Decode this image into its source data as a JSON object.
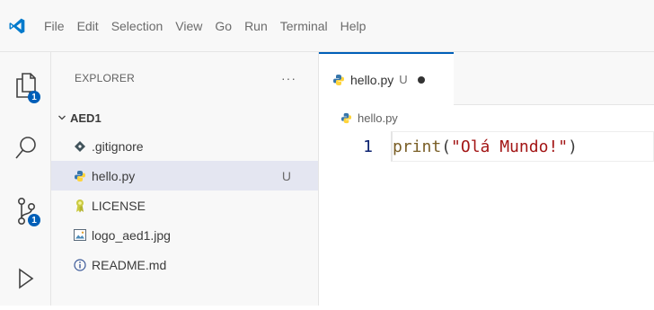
{
  "menu": [
    "File",
    "Edit",
    "Selection",
    "View",
    "Go",
    "Run",
    "Terminal",
    "Help"
  ],
  "activity": {
    "explorer_badge": "1",
    "scm_badge": "1"
  },
  "sidebar": {
    "title": "EXPLORER",
    "more": "···",
    "folder": "AED1",
    "files": [
      {
        "name": ".gitignore",
        "icon": "gitignore-icon",
        "status": ""
      },
      {
        "name": "hello.py",
        "icon": "python-icon",
        "status": "U"
      },
      {
        "name": "LICENSE",
        "icon": "license-icon",
        "status": ""
      },
      {
        "name": "logo_aed1.jpg",
        "icon": "image-icon",
        "status": ""
      },
      {
        "name": "README.md",
        "icon": "info-icon",
        "status": ""
      }
    ]
  },
  "editor": {
    "tab": {
      "name": "hello.py",
      "status": "U"
    },
    "breadcrumb": "hello.py",
    "line_number": "1",
    "code": {
      "fn": "print",
      "open": "(",
      "str": "\"Olá Mundo!\"",
      "close": ")"
    }
  },
  "colors": {
    "accent": "#005fb8",
    "vscode_blue": "#007acc",
    "python_blue": "#3776ab",
    "python_yellow": "#ffd43b"
  }
}
